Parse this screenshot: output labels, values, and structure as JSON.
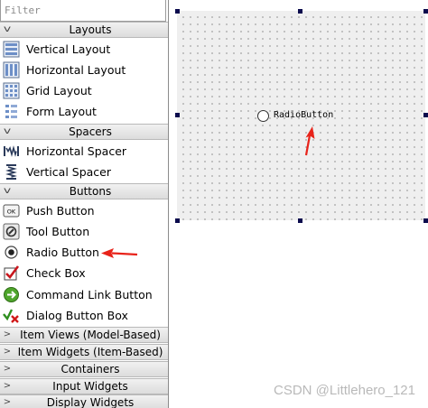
{
  "filter": {
    "placeholder": "Filter"
  },
  "categories": {
    "layouts": "Layouts",
    "spacers": "Spacers",
    "buttons": "Buttons",
    "item_views": "Item Views (Model-Based)",
    "item_widgets": "Item Widgets (Item-Based)",
    "containers": "Containers",
    "input_widgets": "Input Widgets",
    "display_widgets": "Display Widgets"
  },
  "layouts": {
    "vertical": "Vertical Layout",
    "horizontal": "Horizontal Layout",
    "grid": "Grid Layout",
    "form": "Form Layout"
  },
  "spacers": {
    "horizontal": "Horizontal Spacer",
    "vertical": "Vertical Spacer"
  },
  "buttons": {
    "push": "Push Button",
    "tool": "Tool Button",
    "radio": "Radio Button",
    "check": "Check Box",
    "command_link": "Command Link Button",
    "dialog_box": "Dialog Button Box"
  },
  "form": {
    "radio_label": "RadioButton"
  },
  "watermark": "CSDN @Littlehero_121",
  "colors": {
    "arrow": "#e8231a",
    "handle": "#0b0b4d",
    "canvas": "#efefef"
  }
}
